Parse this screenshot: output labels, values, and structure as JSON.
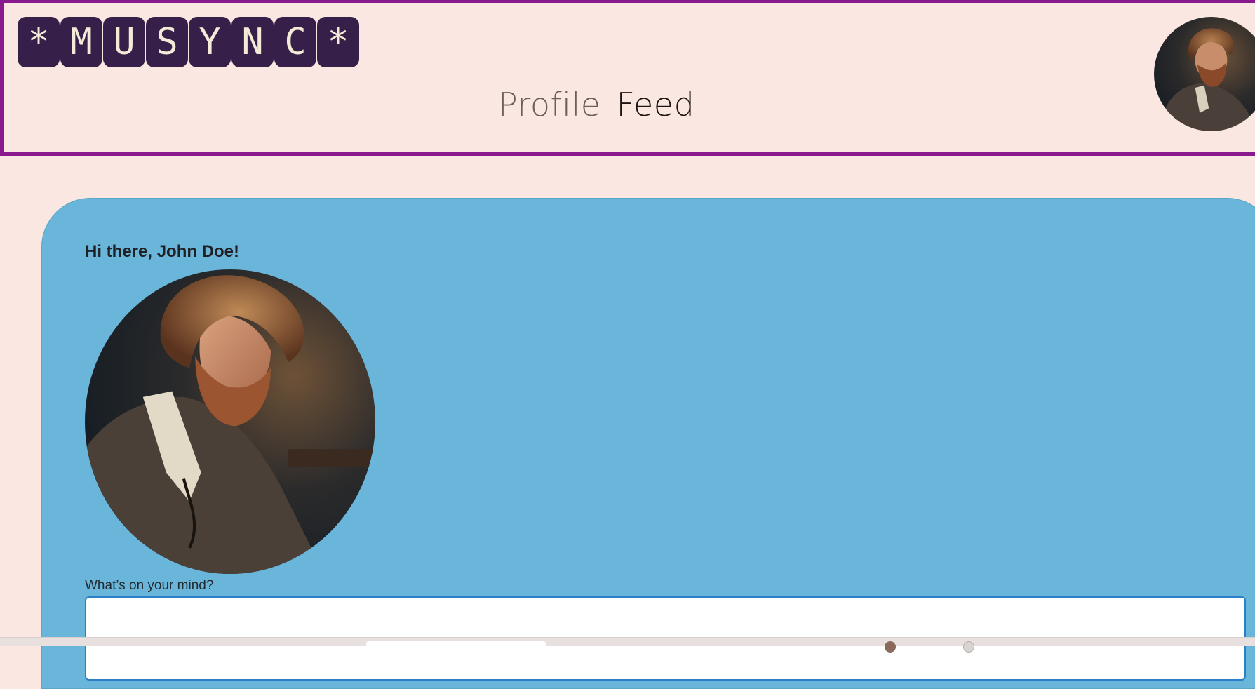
{
  "header": {
    "logo_letters": [
      "*",
      "M",
      "U",
      "S",
      "Y",
      "N",
      "C",
      "*"
    ],
    "nav": {
      "profile_label": "Profile",
      "feed_label": "Feed"
    },
    "avatar_icon": "user-portrait-avatar"
  },
  "main": {
    "greeting": "Hi there, John Doe!",
    "avatar_icon": "user-portrait-avatar",
    "composer": {
      "label": "What’s on your mind?",
      "value": "",
      "placeholder": ""
    }
  },
  "colors": {
    "page_background": "#fae7e1",
    "header_border": "#881a8e",
    "logo_tile": "#362049",
    "card_background": "#6ab6da",
    "input_border": "#2a7fc6"
  }
}
